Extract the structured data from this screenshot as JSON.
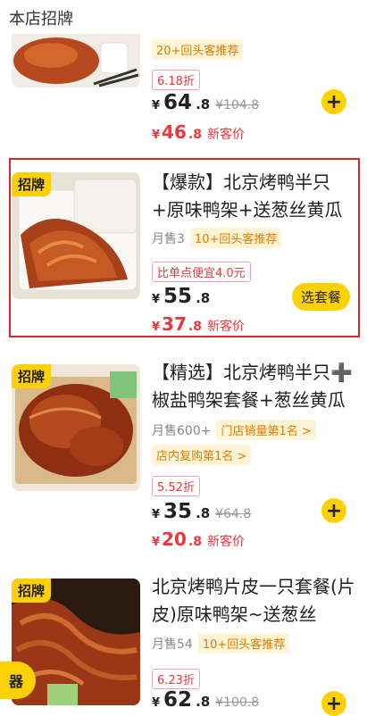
{
  "section_title": "本店招牌",
  "items": [
    {
      "badge": "",
      "title": "",
      "sold": "",
      "tags": [
        "20+回头客推荐"
      ],
      "discount": "6.18折",
      "price_int": "64",
      "price_dec": ".8",
      "orig_price": "¥104.8",
      "new_int": "46",
      "new_dec": ".8",
      "new_label": "新客价",
      "add": "+"
    },
    {
      "badge": "招牌",
      "title": "【爆款】北京烤鸭半只+原味鸭架+送葱丝黄瓜",
      "sold": "月售3",
      "tags": [
        "10+回头客推荐"
      ],
      "promo": "比单点便宜4.0元",
      "price_int": "55",
      "price_dec": ".8",
      "new_int": "37",
      "new_dec": ".8",
      "new_label": "新客价",
      "combo_label": "选套餐"
    },
    {
      "badge": "招牌",
      "title": "【精选】北京烤鸭半只➕椒盐鸭架套餐+葱丝黄瓜",
      "sold": "月售600+",
      "tags": [
        "门店销量第1名 >",
        "店内复购第1名 >"
      ],
      "discount": "5.52折",
      "price_int": "35",
      "price_dec": ".8",
      "orig_price": "¥64.8",
      "new_int": "20",
      "new_dec": ".8",
      "new_label": "新客价",
      "add": "+"
    },
    {
      "badge": "招牌",
      "title": "北京烤鸭片皮一只套餐(片皮)原味鸭架~送葱丝",
      "sold": "月售54",
      "tags": [
        "10+回头客推荐"
      ],
      "discount": "6.23折",
      "price_int": "62",
      "price_dec": ".8",
      "orig_price": "¥100.8",
      "add": "+"
    }
  ],
  "yen": "¥",
  "float_pill_label": "器"
}
